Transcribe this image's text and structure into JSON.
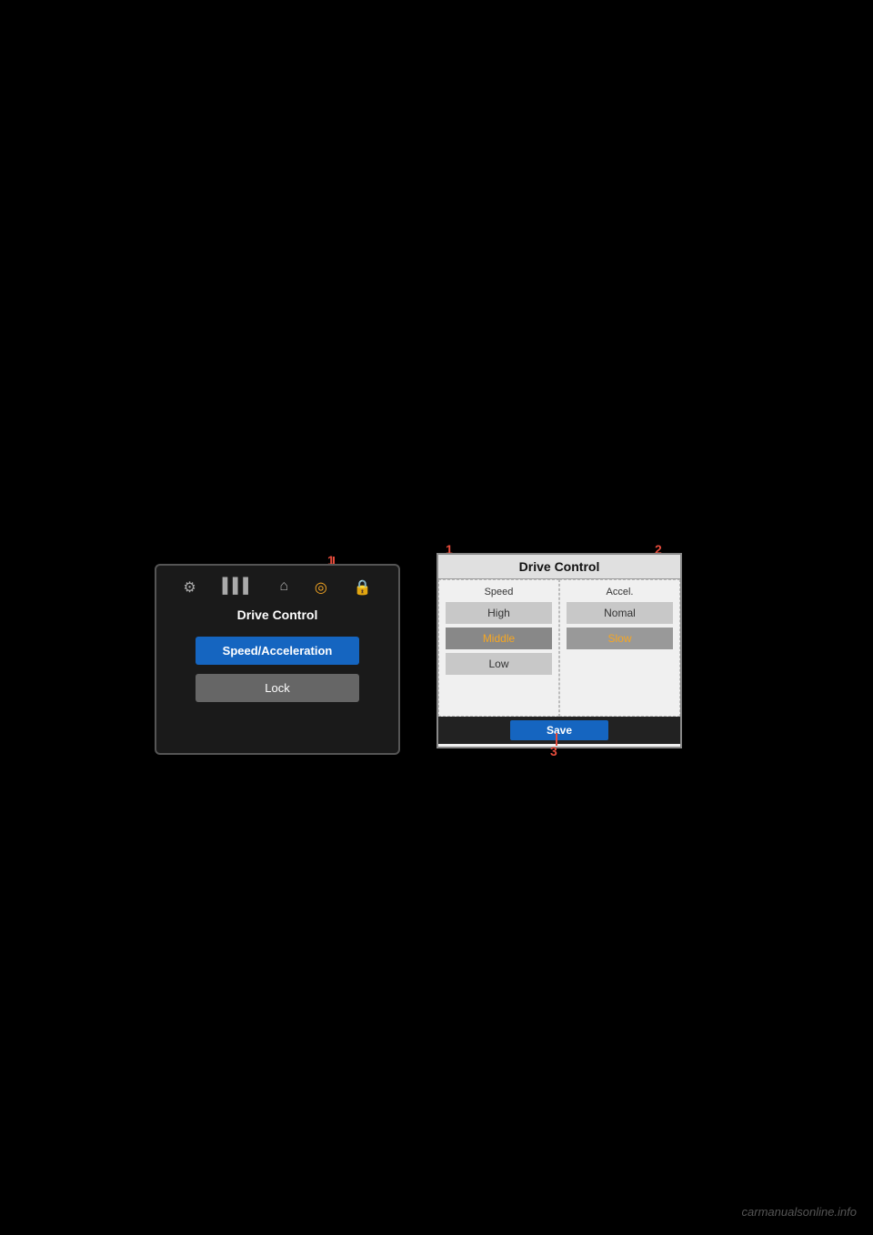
{
  "watermark": {
    "text": "carmanualsonline.info"
  },
  "left_panel": {
    "title": "Drive Control",
    "icons": [
      {
        "name": "gear-icon",
        "symbol": "⚙",
        "active": false
      },
      {
        "name": "signal-icon",
        "symbol": "📶",
        "active": false
      },
      {
        "name": "home-icon",
        "symbol": "⌂",
        "active": false
      },
      {
        "name": "drive-icon",
        "symbol": "◎",
        "active": true
      },
      {
        "name": "lock-icon",
        "symbol": "🔒",
        "active": false
      }
    ],
    "btn_speed_label": "Speed/Acceleration",
    "btn_lock_label": "Lock",
    "label_number": "1"
  },
  "right_panel": {
    "title": "Drive Control",
    "label_1": "1",
    "label_2": "2",
    "label_3": "3",
    "col_speed_header": "Speed",
    "col_accel_header": "Accel.",
    "speed_options": [
      {
        "label": "High",
        "selected": false
      },
      {
        "label": "Middle",
        "selected": true
      },
      {
        "label": "Low",
        "selected": false
      }
    ],
    "accel_options": [
      {
        "label": "Nomal",
        "selected": false
      },
      {
        "label": "Slow",
        "selected": true
      }
    ],
    "btn_save_label": "Save"
  }
}
